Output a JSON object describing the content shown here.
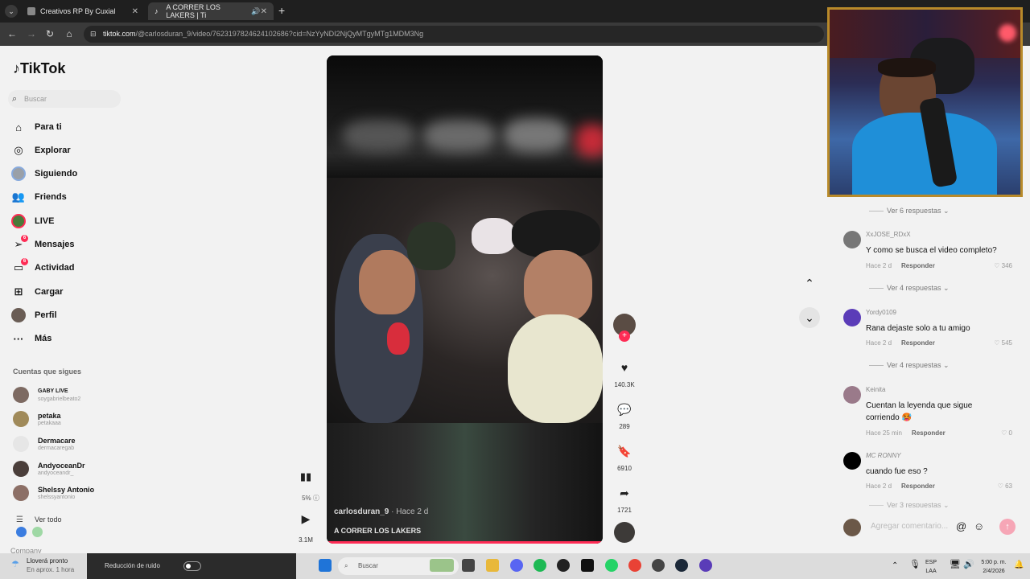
{
  "browser": {
    "tabs": [
      {
        "label": "Creativos RP By Cuxial"
      },
      {
        "label": "A CORRER LOS LAKERS | Ti"
      }
    ],
    "url_host": "tiktok.com",
    "url_path": "/@carlosduran_9/video/7623197824624102686?cid=NzYyNDI2NjQyMTgyMTg1MDM3Ng"
  },
  "sidebar": {
    "logo": "TikTok",
    "search_placeholder": "Buscar",
    "items": [
      {
        "label": "Para ti",
        "icon": "home-icon"
      },
      {
        "label": "Explorar",
        "icon": "compass-icon"
      },
      {
        "label": "Siguiendo",
        "icon": "following-avatar-icon"
      },
      {
        "label": "Friends",
        "icon": "friends-icon"
      },
      {
        "label": "LIVE",
        "icon": "live-icon"
      },
      {
        "label": "Mensajes",
        "icon": "messages-icon",
        "badge": "6"
      },
      {
        "label": "Actividad",
        "icon": "activity-icon",
        "badge": "6"
      },
      {
        "label": "Cargar",
        "icon": "upload-icon"
      },
      {
        "label": "Perfil",
        "icon": "profile-icon"
      },
      {
        "label": "Más",
        "icon": "more-icon"
      }
    ],
    "following_header": "Cuentas que sigues",
    "following": [
      {
        "name": "GABY LIVE",
        "handle": "soygabrielbeato2"
      },
      {
        "name": "petaka",
        "handle": "petakaaa"
      },
      {
        "name": "Dermacare",
        "handle": "dermacaregab"
      },
      {
        "name": "AndyoceanDr",
        "handle": "andyoceandr_"
      },
      {
        "name": "Shelssy Antonio",
        "handle": "shelssyantonio"
      }
    ],
    "see_all": "Ver todo",
    "company": "Company"
  },
  "video": {
    "author": "carlosduran_9",
    "posted": "· Hace 2 d",
    "title": "A CORRER LOS LAKERS",
    "progress": 0.99,
    "stats_percent": "5%",
    "views": "3.1M",
    "likes": "140.3K",
    "comments": "289",
    "saves": "6910",
    "shares": "1721"
  },
  "comments": {
    "replies_top": "Ver 6 respuestas",
    "items": [
      {
        "user": "XxJOSE_RDxX",
        "text": "Y como se busca el video completo?",
        "time": "Hace 2 d",
        "reply": "Responder",
        "likes": "346",
        "replies": "Ver 4 respuestas"
      },
      {
        "user": "Yordy0109",
        "text": "Rana dejaste solo a tu amigo",
        "time": "Hace 2 d",
        "reply": "Responder",
        "likes": "545",
        "replies": "Ver 4 respuestas"
      },
      {
        "user": "Keinita",
        "text": "Cuentan la leyenda que sigue corriendo 🥵",
        "time": "Hace 25 min",
        "reply": "Responder",
        "likes": "0"
      },
      {
        "user": "MC RONNY",
        "text": "cuando fue eso ?",
        "time": "Hace 2 d",
        "reply": "Responder",
        "likes": "63",
        "replies": "Ver 3 respuestas"
      }
    ],
    "add_placeholder": "Agregar comentario..."
  },
  "taskbar": {
    "weather_title": "Lloverá pronto",
    "weather_sub": "En aprox. 1 hora",
    "noise_label": "Reducción de ruido",
    "search": "Buscar",
    "lang": "ESP",
    "lang2": "LAA",
    "time": "5:00 p. m.",
    "date": "2/4/2026"
  }
}
